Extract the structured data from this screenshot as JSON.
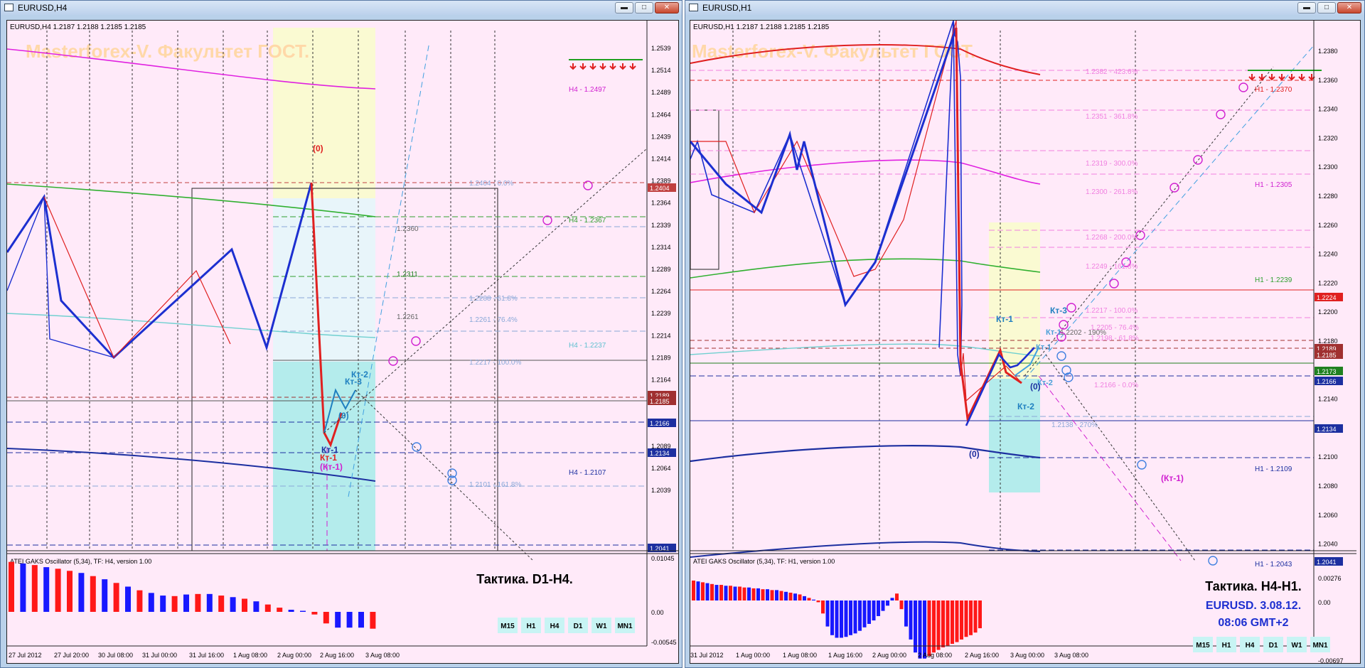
{
  "windows": [
    {
      "title": "EURUSD,H4",
      "ohlc_header": "EURUSD,H4  1.2187 1.2188 1.2185 1.2185",
      "watermark": "Masterforex-V. Факультет ГОСТ.",
      "price_axis_labels": [
        "1.2539",
        "1.2514",
        "1.2489",
        "1.2464",
        "1.2439",
        "1.2414",
        "1.2389",
        "1.2364",
        "1.2339",
        "1.2314",
        "1.2289",
        "1.2264",
        "1.2239",
        "1.2214",
        "1.2189",
        "1.2164",
        "1.2139",
        "1.2114",
        "1.2089",
        "1.2064",
        "1.2039"
      ],
      "price_badges": [
        {
          "text": "1.2404",
          "color": "#c04040"
        },
        {
          "text": "1.2189",
          "color": "#a03030"
        },
        {
          "text": "1.2185",
          "color": "#a03030"
        },
        {
          "text": "1.2166",
          "color": "#1c2fa0"
        },
        {
          "text": "1.2134",
          "color": "#1c2fa0"
        },
        {
          "text": "1.2041",
          "color": "#1c2fa0"
        }
      ],
      "level_labels": [
        {
          "text": "H4 - 1.2497",
          "color": "#d020d0"
        },
        {
          "text": "1.2404 - 0.0%",
          "color": "#8aa8d8"
        },
        {
          "text": "H4 - 1.2367",
          "color": "#30a030"
        },
        {
          "text": "1.2360",
          "color": "#666666"
        },
        {
          "text": "1.2311",
          "color": "#208020"
        },
        {
          "text": "1.2288 - 61.8%",
          "color": "#8aa8d8"
        },
        {
          "text": "1.2261",
          "color": "#666666"
        },
        {
          "text": "1.2261 - 76.4%",
          "color": "#8aa8d8"
        },
        {
          "text": "H4 - 1.2237",
          "color": "#60c0d0"
        },
        {
          "text": "1.2217 - 100.0%",
          "color": "#8aa8d8"
        },
        {
          "text": "H4 - 1.2107",
          "color": "#1c2fa0"
        },
        {
          "text": "1.2101 - 161.8%",
          "color": "#8aa8d8"
        }
      ],
      "annotations": [
        "(0)",
        "Кт-1",
        "Кт-3",
        "Кт-2",
        "(0)",
        "Кт-1",
        "(Кт-1)"
      ],
      "time_axis_labels": [
        "27 Jul 2012",
        "27 Jul 20:00",
        "30 Jul 08:00",
        "31 Jul 00:00",
        "31 Jul 16:00",
        "1 Aug 08:00",
        "2 Aug 00:00",
        "2 Aug 16:00",
        "3 Aug 08:00"
      ],
      "oscillator": {
        "header": "ATEI GAKS Oscillator (5,34), TF: H4, version 1.00",
        "axis_labels": [
          "0.01045",
          "0.00",
          "-0.00545"
        ],
        "values": [
          0.0095,
          0.0092,
          0.0089,
          0.0085,
          0.0082,
          0.0078,
          0.0074,
          0.0068,
          0.0062,
          0.0055,
          0.0048,
          0.0041,
          0.0036,
          0.0031,
          0.003,
          0.0033,
          0.0034,
          0.0034,
          0.0031,
          0.0028,
          0.0025,
          0.002,
          0.0014,
          0.0008,
          0.0004,
          0.0002,
          -0.0005,
          -0.0022,
          -0.003,
          -0.003,
          -0.003,
          -0.0032
        ],
        "colors": [
          "red",
          "blue",
          "red",
          "blue",
          "red",
          "red",
          "blue",
          "red",
          "blue",
          "red",
          "blue",
          "red",
          "blue",
          "blue",
          "red",
          "blue",
          "red",
          "blue",
          "red",
          "blue",
          "red",
          "blue",
          "red",
          "red",
          "blue",
          "blue",
          "red",
          "red",
          "blue",
          "blue",
          "blue",
          "red"
        ]
      },
      "tactic_label": "Тактика. D1-H4.",
      "tactic_sub": [],
      "timeframes": [
        "M15",
        "H1",
        "H4",
        "D1",
        "W1",
        "MN1"
      ],
      "active_tf": "H4"
    },
    {
      "title": "EURUSD,H1",
      "ohlc_header": "EURUSD,H1  1.2187 1.2188 1.2185 1.2185",
      "watermark": "Masterforex-V. Факультет ГОСТ.",
      "price_axis_labels": [
        "1.2380",
        "1.2360",
        "1.2340",
        "1.2320",
        "1.2300",
        "1.2280",
        "1.2260",
        "1.2240",
        "1.2220",
        "1.2200",
        "1.2180",
        "1.2160",
        "1.2140",
        "1.2120",
        "1.2100",
        "1.2080",
        "1.2060",
        "1.2040"
      ],
      "price_badges": [
        {
          "text": "1.2224",
          "color": "#e02020"
        },
        {
          "text": "1.2189",
          "color": "#a03030"
        },
        {
          "text": "1.2185",
          "color": "#a03030"
        },
        {
          "text": "1.2173",
          "color": "#208020"
        },
        {
          "text": "1.2166",
          "color": "#1c2fa0"
        },
        {
          "text": "1.2134",
          "color": "#1c2fa0"
        },
        {
          "text": "1.2041",
          "color": "#1c2fa0"
        }
      ],
      "level_labels": [
        {
          "text": "1.2382 - 423.6%",
          "color": "#f080e0"
        },
        {
          "text": "H1 - 1.2370",
          "color": "#e02020"
        },
        {
          "text": "1.2351 - 361.8%",
          "color": "#f080e0"
        },
        {
          "text": "1.2319 - 300.0%",
          "color": "#f080e0"
        },
        {
          "text": "H1 - 1.2305",
          "color": "#d020d0"
        },
        {
          "text": "1.2300 - 261.8%",
          "color": "#f080e0"
        },
        {
          "text": "1.2268 - 200.0%",
          "color": "#f080e0"
        },
        {
          "text": "1.2249 - 161.8%",
          "color": "#f080e0"
        },
        {
          "text": "H1 - 1.2239",
          "color": "#30a030"
        },
        {
          "text": "1.2217 - 100.0%",
          "color": "#f080e0"
        },
        {
          "text": "1.2202 - 190%",
          "color": "#666666"
        },
        {
          "text": "1.2205 - 76.4%",
          "color": "#f080e0"
        },
        {
          "text": "1.2198 - 61.8%",
          "color": "#f080e0"
        },
        {
          "text": "1.2166 - 0.0%",
          "color": "#f080e0"
        },
        {
          "text": "1.2138 - 270%",
          "color": "#8aa8d8"
        },
        {
          "text": "H1 - 1.2109",
          "color": "#1c2fa0"
        },
        {
          "text": "H1 - 1.2043",
          "color": "#1c2fa0"
        }
      ],
      "annotations": [
        "Кт-1",
        "Кт-3",
        "Кт-1",
        "Кт-1",
        "Кт-2",
        "(0)",
        "Кт-2",
        "(0)",
        "(Кт-1)"
      ],
      "time_axis_labels": [
        "31 Jul 2012",
        "1 Aug 00:00",
        "1 Aug 08:00",
        "1 Aug 16:00",
        "2 Aug 00:00",
        "2 Aug 08:00",
        "2 Aug 16:00",
        "3 Aug 00:00",
        "3 Aug 08:00"
      ],
      "oscillator": {
        "header": "ATEI GAKS Oscillator (5,34), TF: H1, version 1.00",
        "axis_labels": [
          "0.00276",
          "0.00",
          "-0.00697"
        ],
        "values": [
          0.0023,
          0.0022,
          0.0021,
          0.002,
          0.0019,
          0.0018,
          0.0018,
          0.0017,
          0.0017,
          0.0016,
          0.0016,
          0.0015,
          0.0015,
          0.0014,
          0.0014,
          0.0013,
          0.0013,
          0.0012,
          0.0012,
          0.0011,
          0.001,
          0.0009,
          0.0008,
          0.0007,
          0.0005,
          0.0003,
          0.0001,
          -0.0002,
          -0.0015,
          -0.003,
          -0.004,
          -0.0043,
          -0.0043,
          -0.0042,
          -0.004,
          -0.0038,
          -0.0035,
          -0.0031,
          -0.0027,
          -0.0023,
          -0.0018,
          -0.0012,
          -0.0006,
          0.0003,
          0.0008,
          -0.001,
          -0.003,
          -0.0045,
          -0.006,
          -0.0067,
          -0.0067,
          -0.0064,
          -0.006,
          -0.0057,
          -0.0054,
          -0.0052,
          -0.005,
          -0.0048,
          -0.0045,
          -0.0042,
          -0.004,
          -0.0037,
          -0.0032
        ],
        "colors": [
          "red",
          "blue",
          "red",
          "blue",
          "red",
          "blue",
          "red",
          "blue",
          "red",
          "blue",
          "red",
          "red",
          "blue",
          "red",
          "blue",
          "red",
          "blue",
          "red",
          "blue",
          "red",
          "blue",
          "red",
          "blue",
          "red",
          "blue",
          "red",
          "blue",
          "red",
          "red",
          "blue",
          "blue",
          "blue",
          "blue",
          "blue",
          "blue",
          "blue",
          "blue",
          "blue",
          "blue",
          "blue",
          "blue",
          "blue",
          "blue",
          "blue",
          "red",
          "red",
          "blue",
          "blue",
          "blue",
          "blue",
          "blue",
          "red",
          "red",
          "red",
          "red",
          "red",
          "red",
          "red",
          "red",
          "red",
          "red",
          "red",
          "red"
        ]
      },
      "tactic_label": "Тактика. H4-H1.",
      "tactic_sub": [
        "EURUSD. 3.08.12.",
        "08:06  GMT+2"
      ],
      "timeframes": [
        "M15",
        "H1",
        "H4",
        "D1",
        "W1",
        "MN1"
      ],
      "active_tf": "H4"
    }
  ],
  "colors": {
    "chart_bg": "#ffeaf9",
    "bull": "#1c2fd0",
    "bear": "#ee1c1c",
    "tf_button": "#c8f4f4"
  }
}
